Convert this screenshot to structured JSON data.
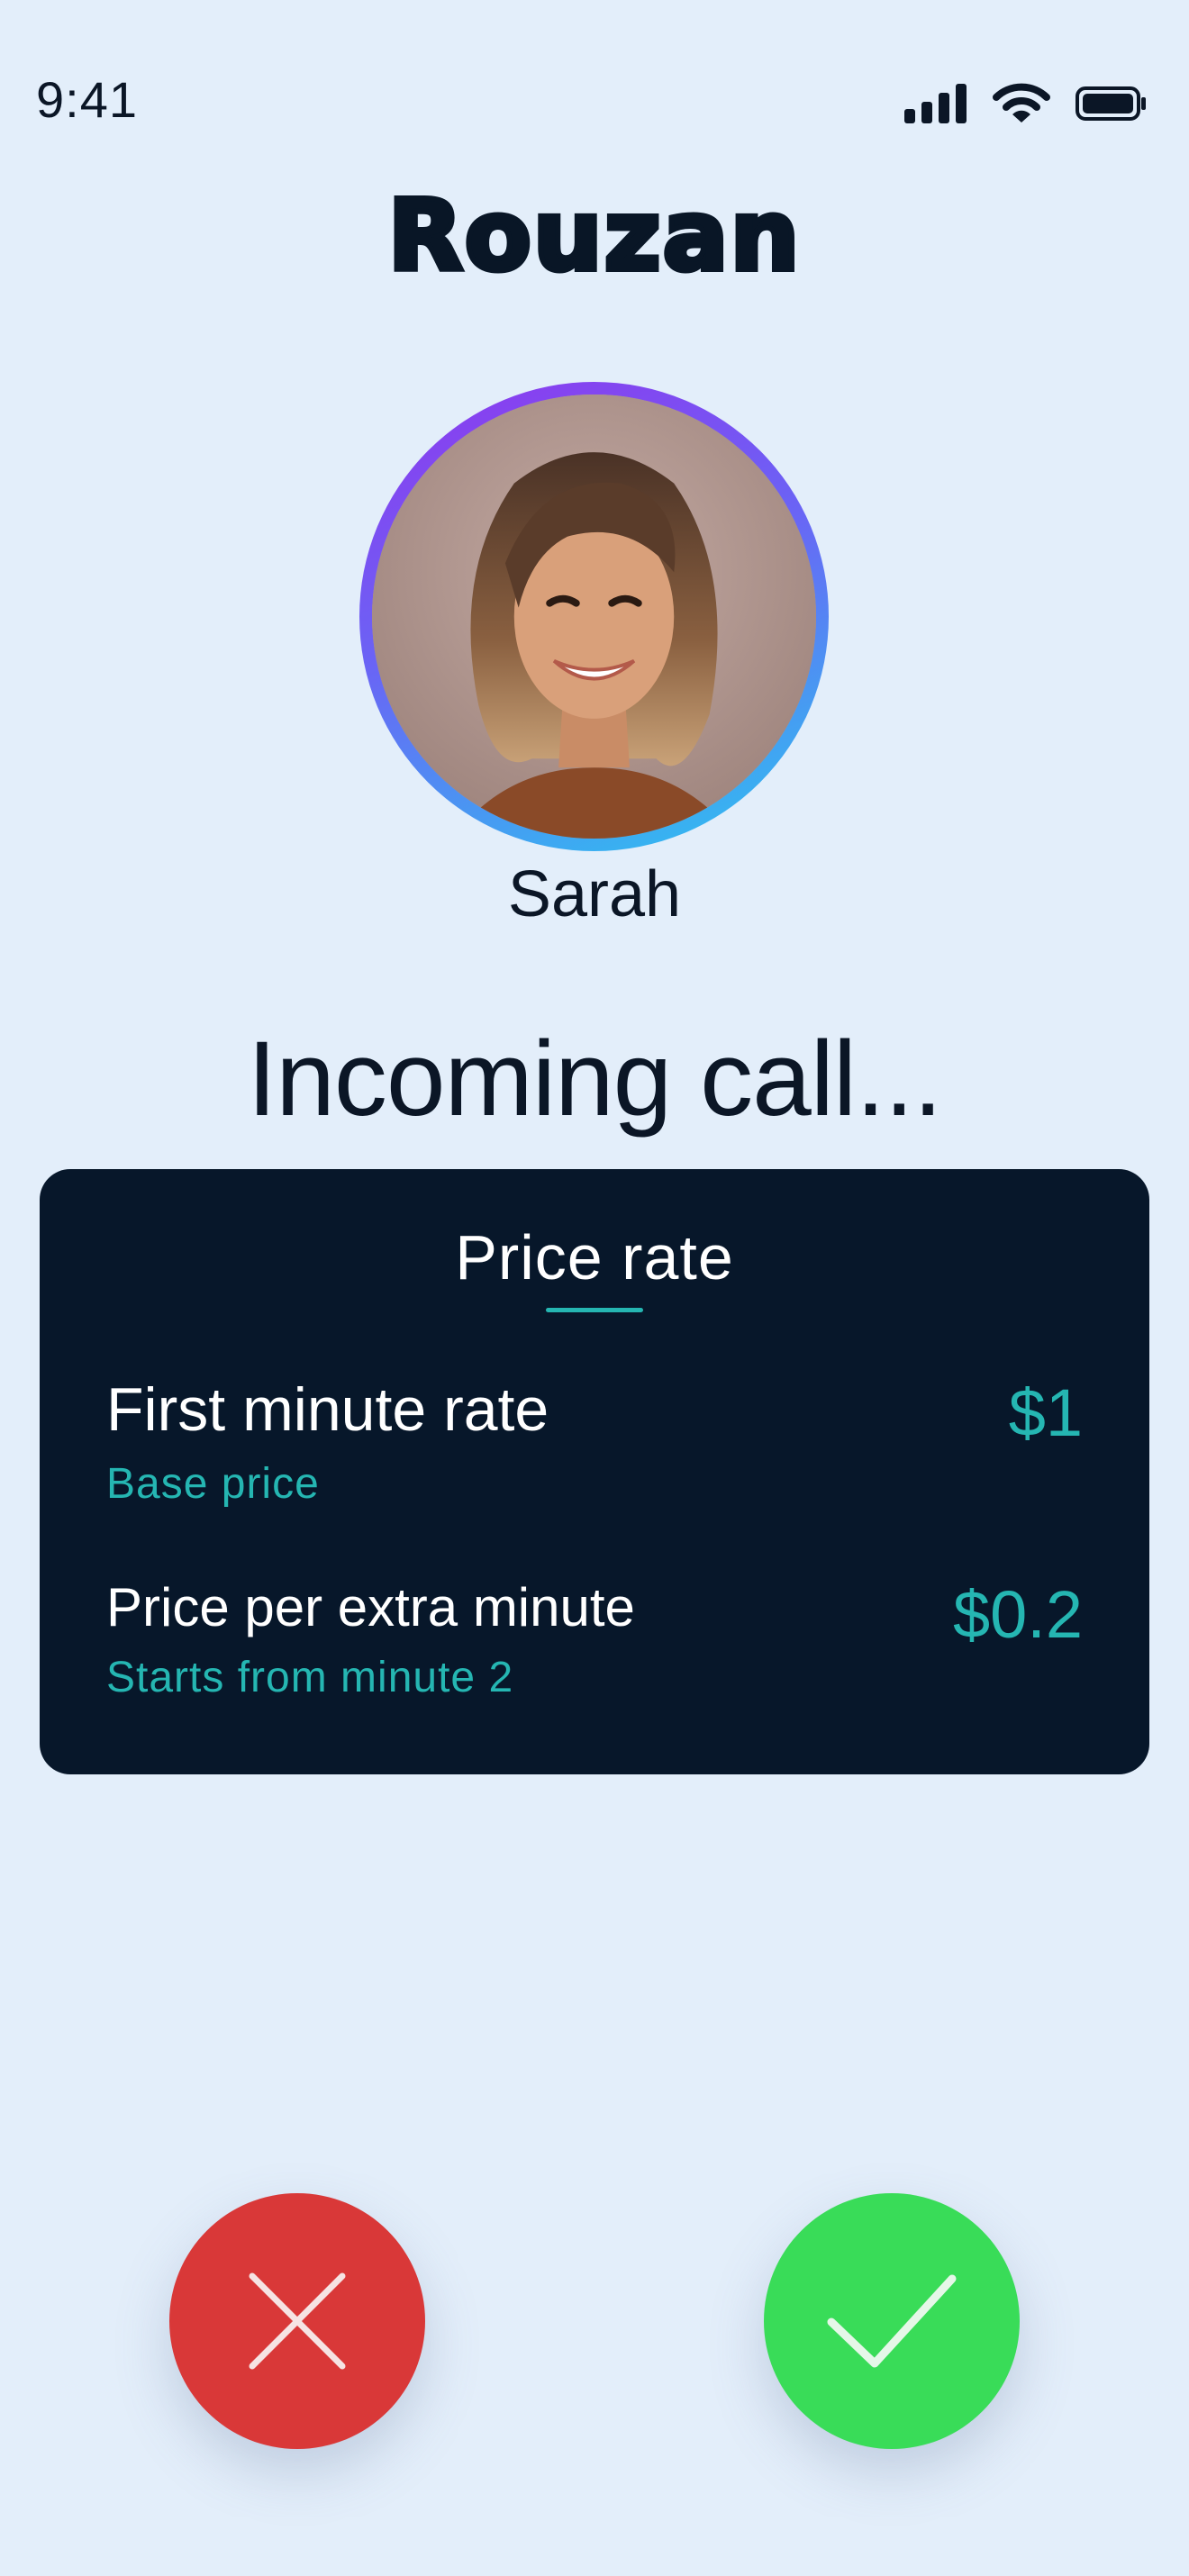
{
  "status_bar": {
    "time": "9:41",
    "icons": [
      "cellular-signal-icon",
      "wifi-icon",
      "battery-icon"
    ]
  },
  "app": {
    "logo_text": "Rouzan"
  },
  "caller": {
    "name": "Sarah",
    "avatar": "caller-photo"
  },
  "call": {
    "status": "Incoming call..."
  },
  "price_card": {
    "title": "Price rate",
    "rates": [
      {
        "label": "First minute rate",
        "sublabel": "Base price",
        "value": "$1"
      },
      {
        "label": "Price per extra minute",
        "sublabel": "Starts from minute 2",
        "value": "$0.2"
      }
    ]
  },
  "actions": {
    "decline": {
      "icon": "close-icon",
      "color": "#d93838"
    },
    "accept": {
      "icon": "checkmark-icon",
      "color": "#39dc58"
    }
  },
  "colors": {
    "background": "#e3eefa",
    "card": "#07172a",
    "accent": "#25b6b2",
    "ring_start": "#8f37ee",
    "ring_end": "#2bc6f0"
  }
}
